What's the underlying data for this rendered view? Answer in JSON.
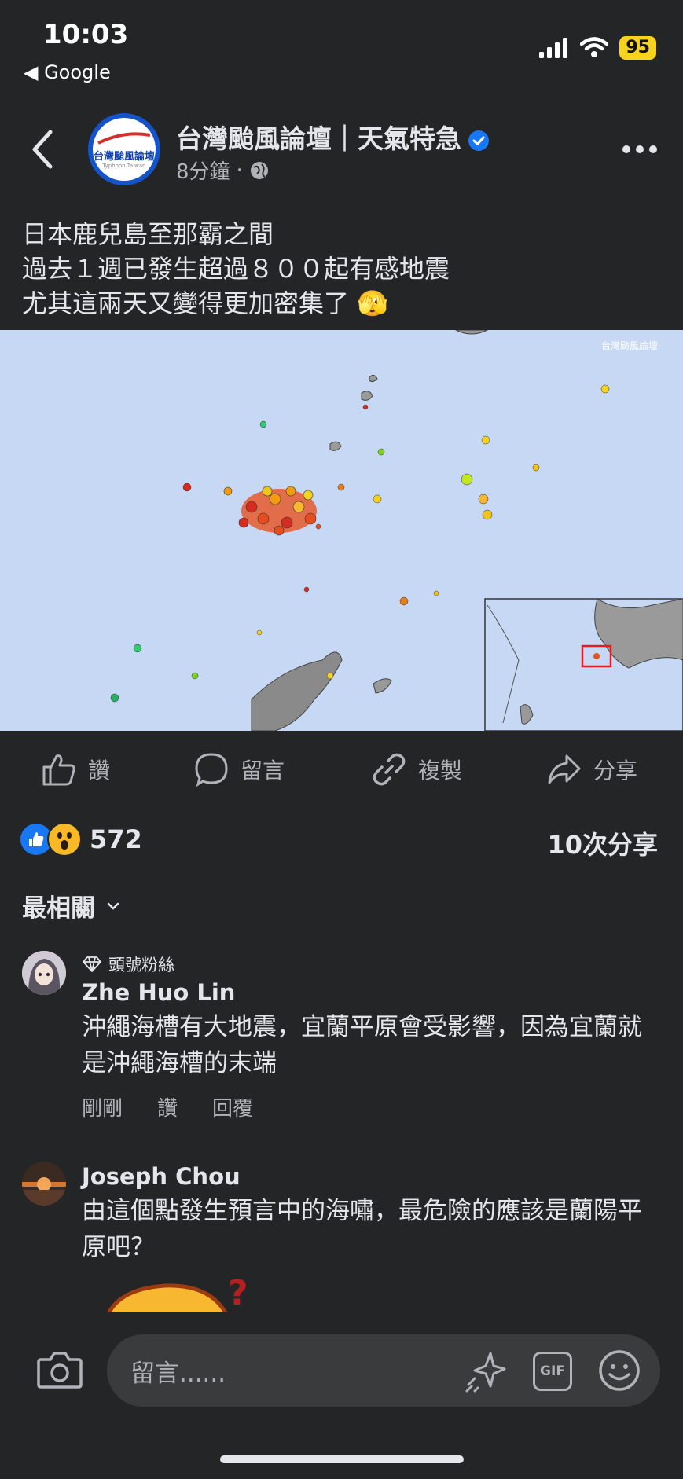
{
  "status_bar": {
    "time": "10:03",
    "back_app": "◀ Google",
    "battery": "95"
  },
  "post": {
    "page_name": "台灣颱風論壇｜天氣特急",
    "age": "8分鐘",
    "avatar_text": "台灣颱風論壇",
    "avatar_sub": "Typhoon Taiwan",
    "text_lines": [
      "日本鹿兒島至那霸之間",
      "過去１週已發生超過８００起有感地震",
      "尤其這兩天又變得更加密集了 🫣"
    ],
    "map_watermark": "台灣颱風論壇"
  },
  "actions": {
    "like": "讚",
    "comment": "留言",
    "copy": "複製",
    "share": "分享"
  },
  "stats": {
    "reaction_count": "572",
    "shares": "10次分享"
  },
  "sort_label": "最相關",
  "comments": [
    {
      "badge": "頭號粉絲",
      "name": "Zhe Huo Lin",
      "text": "沖繩海槽有大地震，宜蘭平原會受影響，因為宜蘭就是沖繩海槽的末端",
      "time": "剛剛",
      "like": "讚",
      "reply": "回覆"
    },
    {
      "name": "Joseph Chou",
      "text": "由這個點發生預言中的海嘯，最危險的應該是蘭陽平原吧？"
    }
  ],
  "composer": {
    "placeholder": "留言......",
    "gif": "GIF"
  },
  "colors": {
    "background": "#242526",
    "text": "#e4e6eb",
    "secondary": "#b0b3b8",
    "like_blue": "#1877f2",
    "battery": "#f7d21e"
  },
  "icons": [
    "signal-icon",
    "wifi-icon",
    "back-arrow-icon",
    "verified-icon",
    "globe-icon",
    "more-icon",
    "like-icon",
    "comment-icon",
    "link-icon",
    "share-icon",
    "chevron-down-icon",
    "diamond-icon",
    "camera-icon",
    "sparkle-icon",
    "gif-icon",
    "emoji-icon"
  ]
}
